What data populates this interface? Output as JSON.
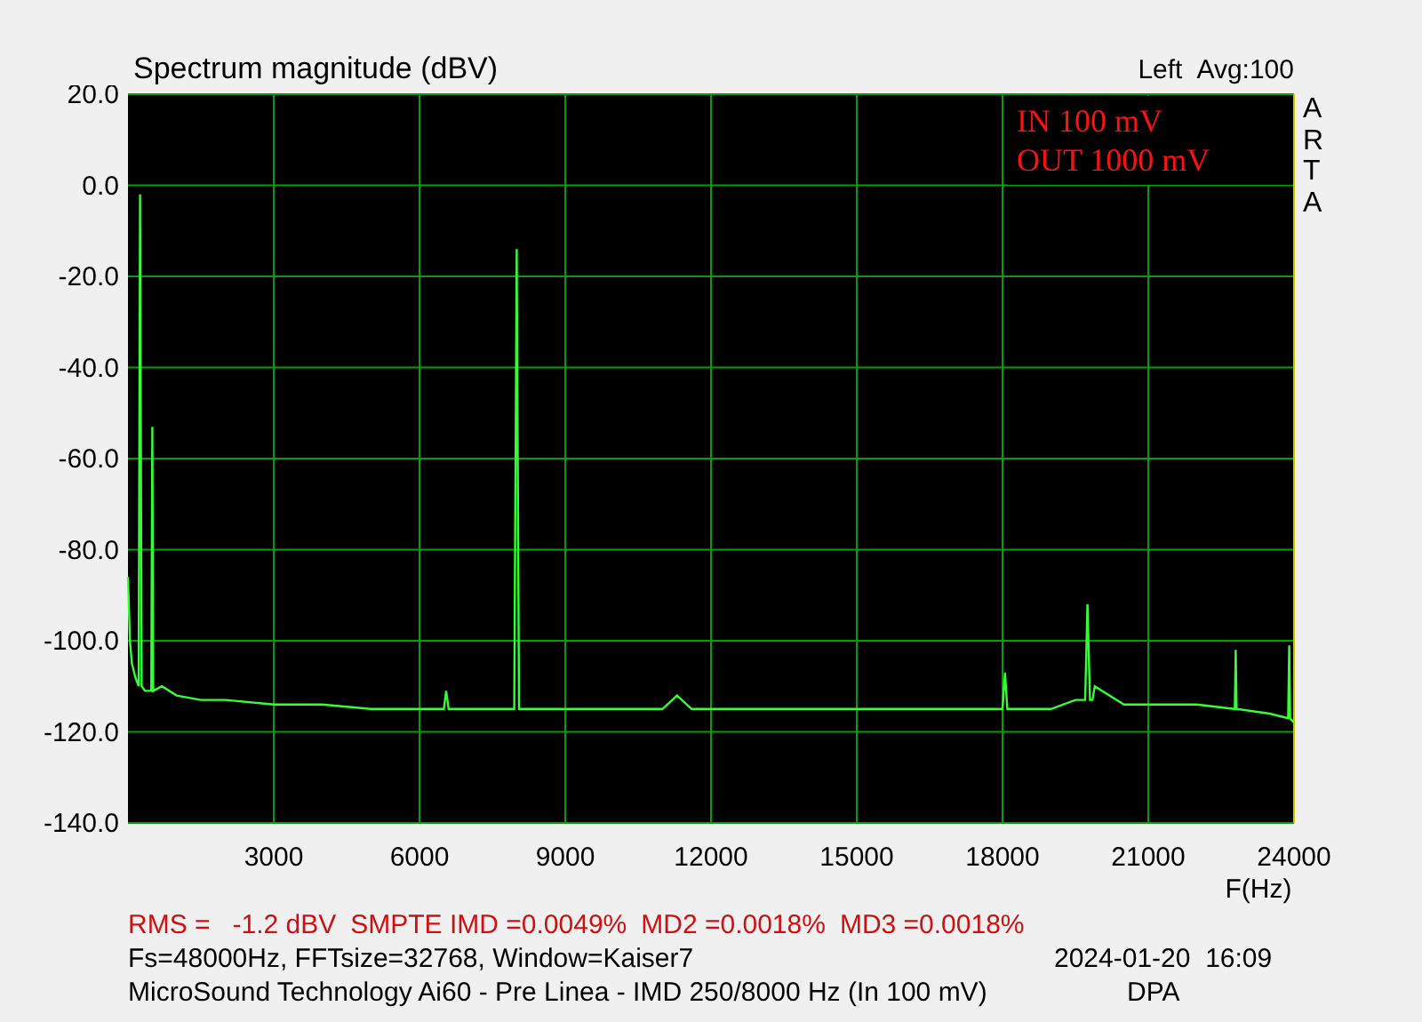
{
  "header": {
    "title": "Spectrum magnitude (dBV)",
    "average": "Avg:100"
  },
  "brand": "ARTA",
  "chart_data": {
    "type": "line",
    "grid": true,
    "xlabel": "F(Hz)",
    "xlim": [
      0,
      24000
    ],
    "ylim": [
      -140,
      20
    ],
    "xticks": [
      3000,
      6000,
      9000,
      12000,
      15000,
      18000,
      21000,
      24000
    ],
    "yticks": [
      {
        "value": 20,
        "label": "20.0"
      },
      {
        "value": 0,
        "label": "0.0"
      },
      {
        "value": -20,
        "label": "-20.0"
      },
      {
        "value": -40,
        "label": "-40.0"
      },
      {
        "value": -60,
        "label": "-60.0"
      },
      {
        "value": -80,
        "label": "-80.0"
      },
      {
        "value": -100,
        "label": "-100.0"
      },
      {
        "value": -120,
        "label": "-120.0"
      },
      {
        "value": -140,
        "label": "-140.0"
      }
    ],
    "x": [
      0,
      40,
      80,
      150,
      220,
      250,
      280,
      350,
      480,
      500,
      520,
      700,
      1000,
      1500,
      2000,
      3000,
      4000,
      5000,
      6000,
      6500,
      6550,
      6600,
      7000,
      7900,
      7950,
      8000,
      8050,
      8100,
      9000,
      10000,
      11000,
      11300,
      11600,
      12000,
      14000,
      16000,
      18000,
      18050,
      18100,
      18150,
      19000,
      19500,
      19700,
      19750,
      19800,
      19850,
      19900,
      20500,
      21000,
      22000,
      22780,
      22800,
      22820,
      23500,
      23880,
      23900,
      23920,
      24000
    ],
    "series": [
      {
        "name": "Left",
        "color": "#33ff33",
        "values": [
          -86,
          -100,
          -105,
          -108,
          -110,
          -2,
          -110,
          -111,
          -111,
          -53,
          -111,
          -110,
          -112,
          -113,
          -113,
          -114,
          -114,
          -115,
          -115,
          -115,
          -111,
          -115,
          -115,
          -115,
          -115,
          -14,
          -115,
          -115,
          -115,
          -115,
          -115,
          -112,
          -115,
          -115,
          -115,
          -115,
          -115,
          -107,
          -115,
          -115,
          -115,
          -113,
          -113,
          -92,
          -113,
          -113,
          -110,
          -114,
          -114,
          -114,
          -115,
          -102,
          -115,
          -116,
          -117,
          -101,
          -117,
          -118
        ]
      }
    ],
    "annotations": [
      "IN 100 mV",
      "OUT 1000 mV"
    ]
  },
  "measurements": [
    "RMS =   -1.2 dBV",
    "SMPTE IMD =0.0049%",
    "MD2 =0.0018%",
    "MD3 =0.0018%"
  ],
  "settings": "Fs=48000Hz, FFTsize=32768, Window=Kaiser7",
  "timestamp": "2024-01-20  16:09",
  "description": "MicroSound Technology Ai60 - Pre Linea - IMD 250/8000 Hz (In 100 mV)",
  "author": "DPA"
}
